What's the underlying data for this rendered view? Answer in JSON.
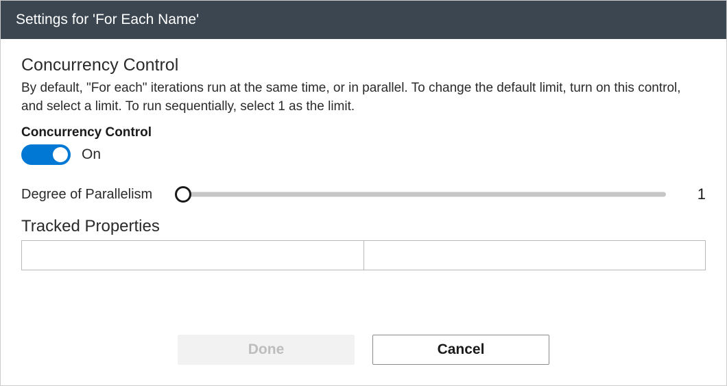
{
  "header": {
    "title": "Settings for 'For Each Name'"
  },
  "concurrency": {
    "title": "Concurrency Control",
    "description": "By default, \"For each\" iterations run at the same time, or in parallel. To change the default limit, turn on this control, and select a limit. To run sequentially, select 1 as the limit.",
    "toggle_label": "Concurrency Control",
    "toggle_state": "On",
    "parallelism_label": "Degree of Parallelism",
    "parallelism_value": "1"
  },
  "tracked": {
    "title": "Tracked Properties",
    "col1": "",
    "col2": ""
  },
  "footer": {
    "done": "Done",
    "cancel": "Cancel"
  }
}
